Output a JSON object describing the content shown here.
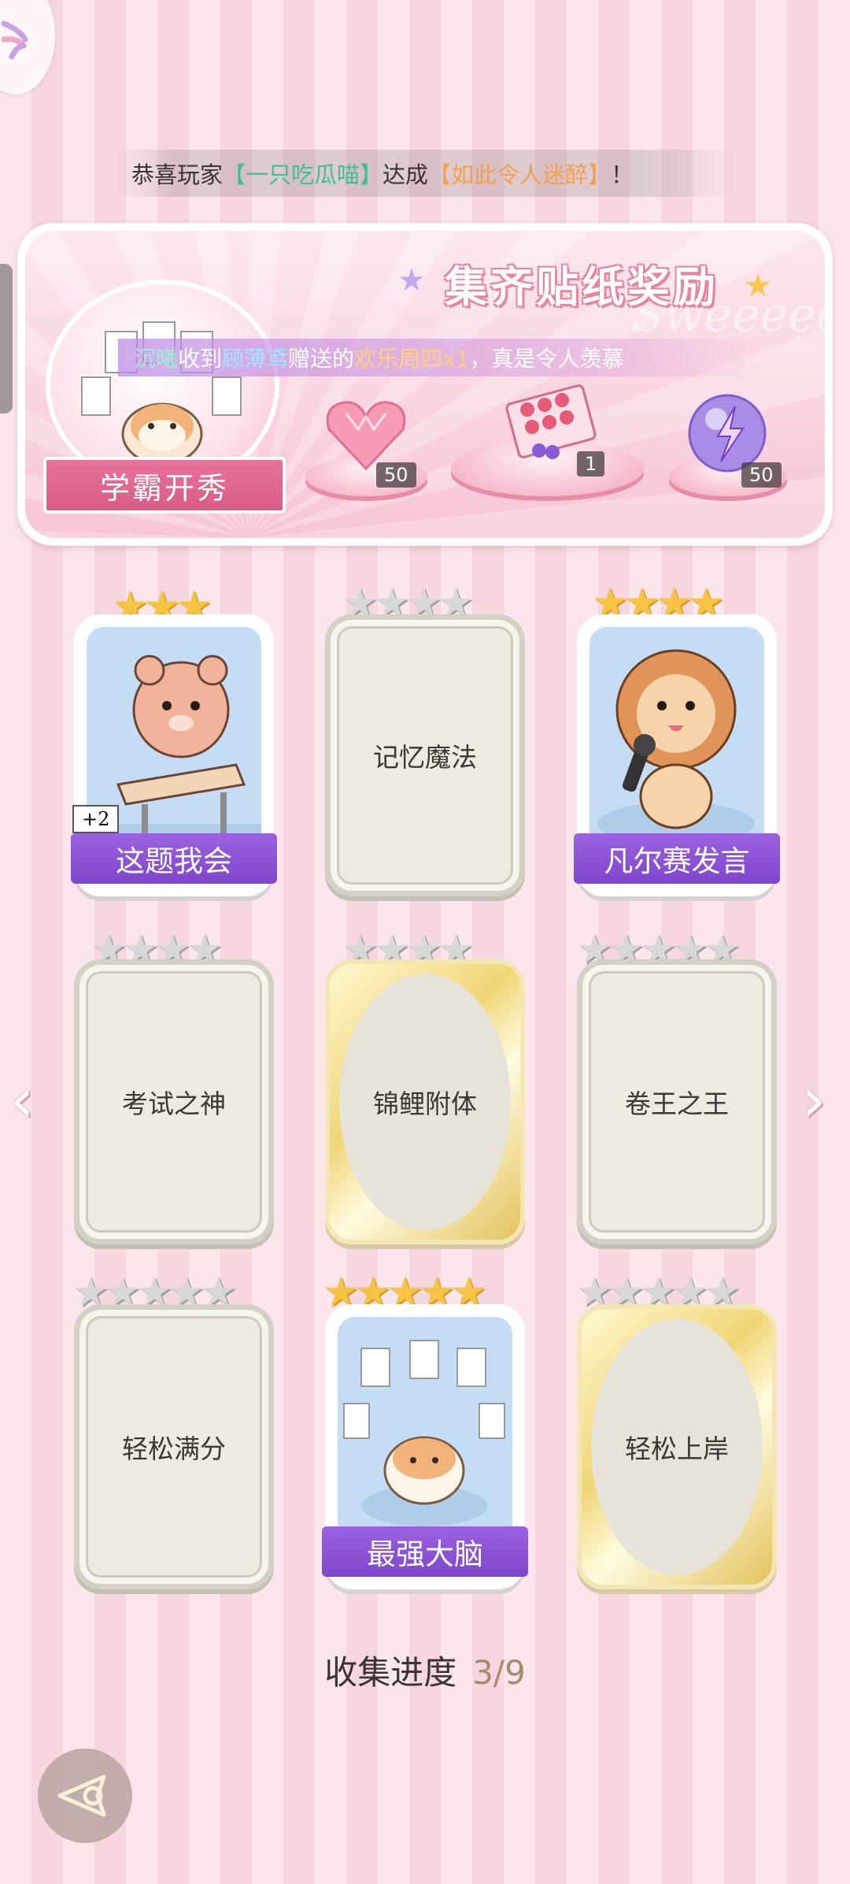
{
  "announcement": {
    "prefix": "恭喜玩家",
    "player": "【一只吃瓜喵】",
    "mid": "达成",
    "achievement": "【如此令人迷醉】",
    "suffix": "！"
  },
  "banner": {
    "title": "集齐贴纸奖励",
    "watermark": "Sweeeeem",
    "badge": "学霸开秀",
    "message": {
      "user": "沉曦",
      "t1": "收到",
      "sender": "顾薄鸢",
      "t2": "赠送的",
      "gift": "欢乐周四x1",
      "t3": "，真是令人羡慕"
    },
    "rewards": [
      {
        "icon": "pink-heart-gem-icon",
        "count": "50"
      },
      {
        "icon": "gift-box-icon",
        "count": "1"
      },
      {
        "icon": "purple-lightning-orb-icon",
        "count": "50"
      }
    ]
  },
  "cards": [
    {
      "name": "这题我会",
      "stars": 3,
      "filled": 3,
      "state": "owned",
      "extra": "+2",
      "art": "bear-at-desk"
    },
    {
      "name": "记忆魔法",
      "stars": 4,
      "filled": 0,
      "state": "locked-silver"
    },
    {
      "name": "凡尔赛发言",
      "stars": 4,
      "filled": 4,
      "state": "owned",
      "art": "lion-with-microphone"
    },
    {
      "name": "考试之神",
      "stars": 4,
      "filled": 0,
      "state": "locked-silver"
    },
    {
      "name": "锦鲤附体",
      "stars": 4,
      "filled": 0,
      "state": "locked-gold"
    },
    {
      "name": "卷王之王",
      "stars": 5,
      "filled": 0,
      "state": "locked-silver"
    },
    {
      "name": "轻松满分",
      "stars": 5,
      "filled": 0,
      "state": "locked-silver"
    },
    {
      "name": "最强大脑",
      "stars": 5,
      "filled": 5,
      "state": "owned",
      "art": "cat-with-papers"
    },
    {
      "name": "轻松上岸",
      "stars": 5,
      "filled": 0,
      "state": "locked-gold"
    }
  ],
  "progress": {
    "label": "收集进度",
    "value": "3/9"
  },
  "colors": {
    "accent_pink": "#e8729a",
    "ribbon_purple": "#8a52d6",
    "star_gold": "#f7c342"
  }
}
